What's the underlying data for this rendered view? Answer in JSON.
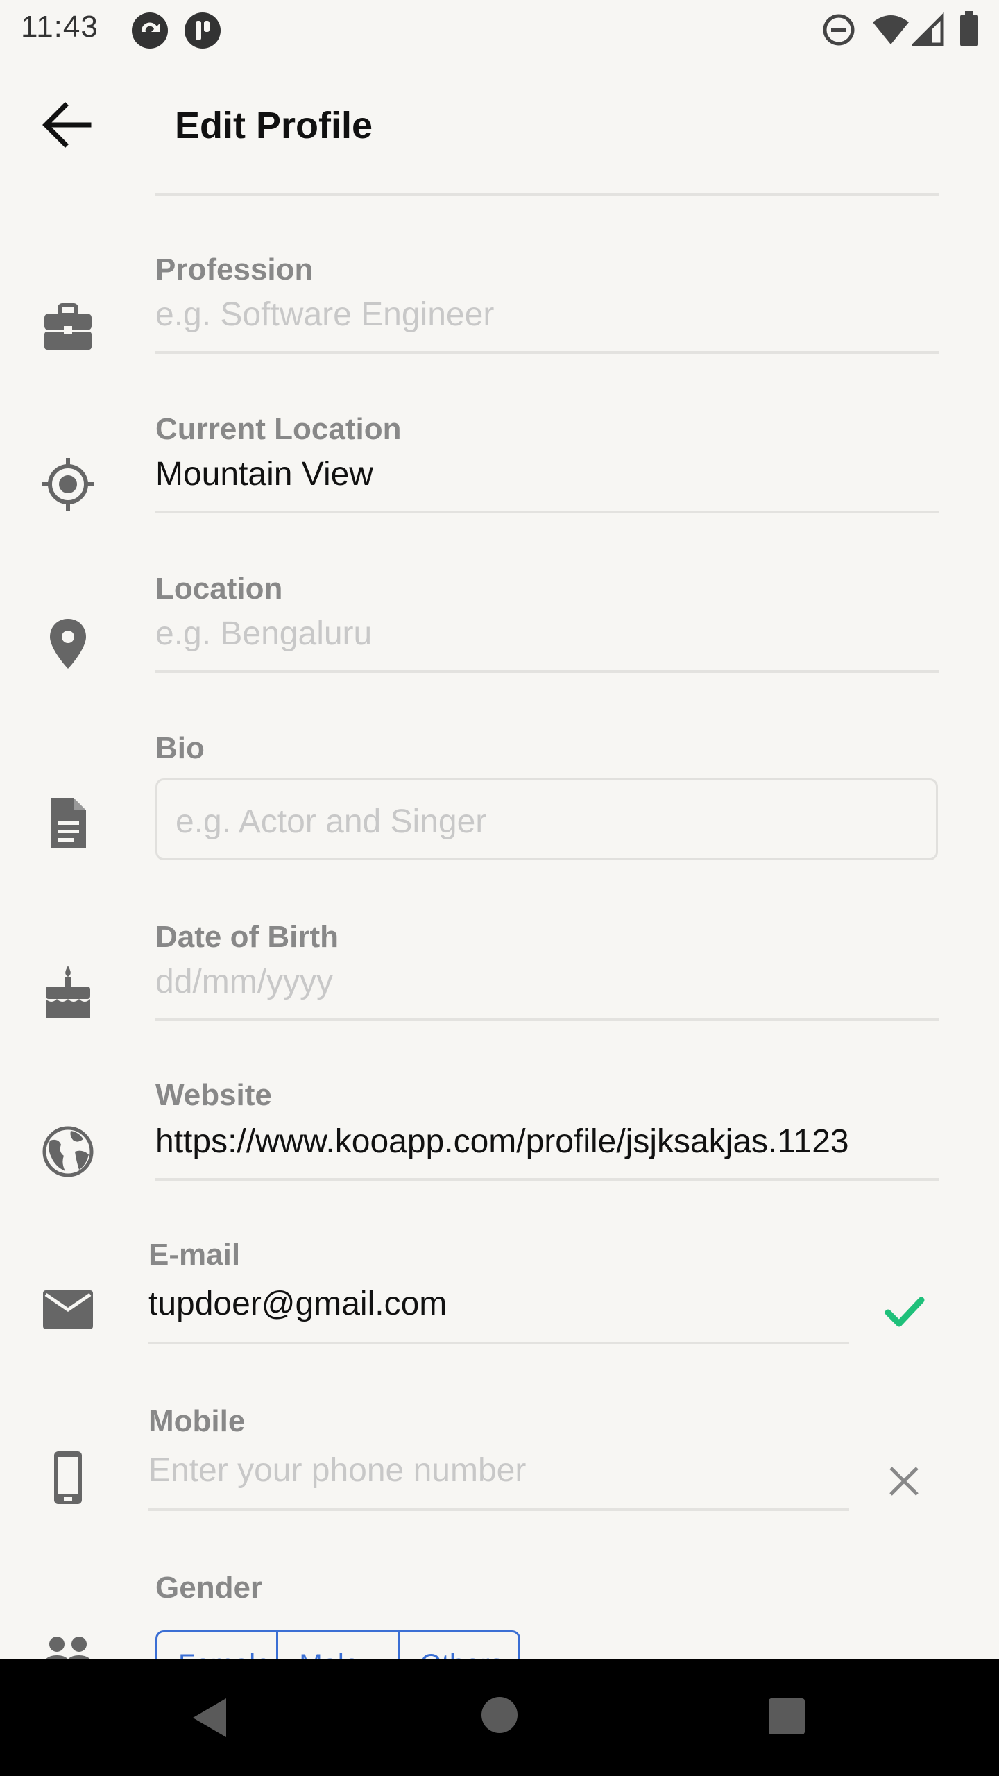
{
  "status_bar": {
    "time": "11:43"
  },
  "header": {
    "title": "Edit Profile"
  },
  "fields": {
    "profession": {
      "label": "Profession",
      "placeholder": "e.g. Software Engineer",
      "icon": "briefcase-icon"
    },
    "current_location": {
      "label": "Current Location",
      "value": "Mountain View",
      "icon": "gps-target-icon"
    },
    "location": {
      "label": "Location",
      "placeholder": "e.g. Bengaluru",
      "icon": "map-pin-icon"
    },
    "bio": {
      "label": "Bio",
      "placeholder": "e.g. Actor and Singer",
      "icon": "document-icon"
    },
    "dob": {
      "label": "Date of Birth",
      "placeholder": "dd/mm/yyyy",
      "icon": "cake-icon"
    },
    "website": {
      "label": "Website",
      "value": "https://www.kooapp.com/profile/jsjksakjas.1123",
      "icon": "globe-icon"
    },
    "email": {
      "label": "E-mail",
      "value": "tupdoer@gmail.com",
      "icon": "envelope-icon",
      "status_icon": "check-icon",
      "status_color": "#1fc07a"
    },
    "mobile": {
      "label": "Mobile",
      "placeholder": "Enter your phone number",
      "icon": "phone-icon",
      "status_icon": "close-icon"
    },
    "gender": {
      "label": "Gender",
      "icon": "people-icon",
      "options": [
        "Female",
        "Male",
        "Others"
      ]
    }
  },
  "colors": {
    "background": "#f7f6f3",
    "label": "#888888",
    "accent": "#3b6fd4"
  }
}
